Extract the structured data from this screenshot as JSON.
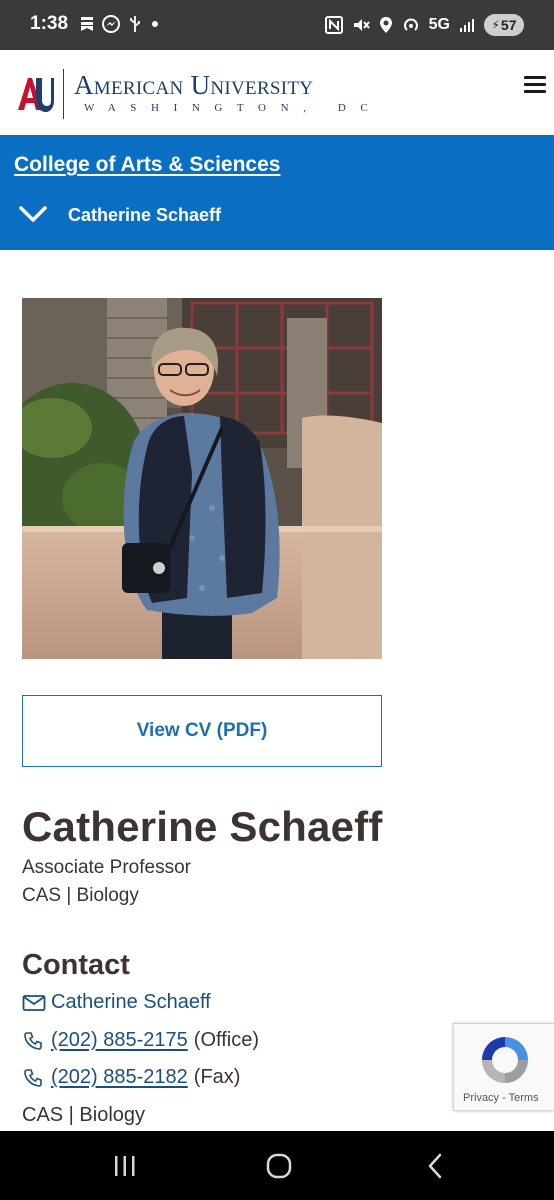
{
  "status_bar": {
    "time": "1:38",
    "network": "5G",
    "battery": "57",
    "left_icons": [
      "bookmark-icon",
      "messenger-icon",
      "usb-icon",
      "dot-icon"
    ],
    "right_icons": [
      "nfc-icon",
      "mute-icon",
      "location-icon",
      "hotspot-icon",
      "signal-icon",
      "battery-icon"
    ]
  },
  "header": {
    "logo_mark": "AU",
    "title": "American University",
    "subtitle": "WASHINGTON, DC",
    "menu_icon": "hamburger-icon"
  },
  "section_bar": {
    "college": "College of Arts & Sciences",
    "current": "Catherine Schaeff",
    "chevron_icon": "chevron-down-icon"
  },
  "profile": {
    "cv_button": "View CV (PDF)",
    "name": "Catherine Schaeff",
    "title": "Associate Professor",
    "dept": "CAS | Biology"
  },
  "contact": {
    "heading": "Contact",
    "email_name": "Catherine Schaeff",
    "phone_office": "(202) 885-2175",
    "phone_office_label": "(Office)",
    "phone_fax": "(202) 885-2182",
    "phone_fax_label": "(Fax)",
    "dept": "CAS | Biology"
  },
  "recaptcha": {
    "privacy": "Privacy",
    "separator": "-",
    "terms": "Terms"
  },
  "colors": {
    "brand_blue": "#0a6fc2",
    "navy": "#1d3f6e",
    "au_red": "#c8102e",
    "text_dark": "#3d3431"
  }
}
